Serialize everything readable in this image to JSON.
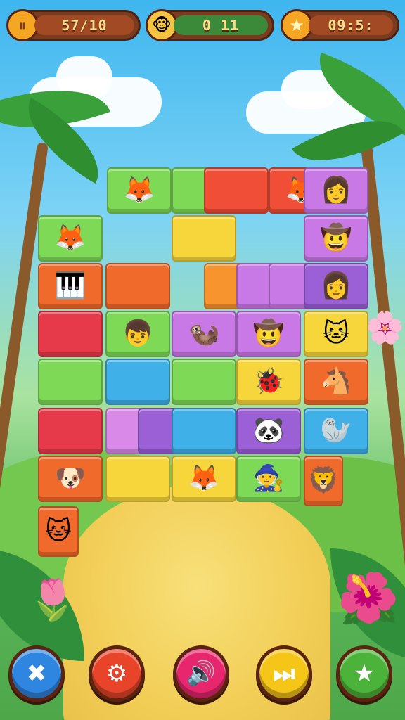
{
  "hud": {
    "left": {
      "icon": "pause-icon",
      "value": "57/10",
      "icon_color": "#f5a623"
    },
    "center": {
      "icon": "avatar-icon",
      "value": "0 11",
      "icon_color": "#f5c542"
    },
    "right": {
      "icon": "star-icon",
      "value": "09:5:",
      "icon_color": "#f5a623"
    }
  },
  "tiles": [
    {
      "color": "#7ed957",
      "icon": "fox-icon",
      "glyph": "🦊"
    },
    {
      "color": "#7ed957",
      "icon": "vine-icon",
      "glyph": ""
    },
    {
      "color": "#f04e37",
      "icon": "vine-icon",
      "glyph": ""
    },
    {
      "color": "#f04e37",
      "icon": "fox-icon",
      "glyph": "🦊"
    },
    {
      "color": "#c979e6",
      "icon": "girl-icon",
      "glyph": "👩"
    },
    {
      "color": "#7ed957",
      "icon": "fox-icon",
      "glyph": "🦊"
    },
    {
      "color": "#f7d63b",
      "icon": "vine-icon",
      "glyph": ""
    },
    {
      "color": "#c979e6",
      "icon": "explorer-icon",
      "glyph": "🤠"
    },
    {
      "color": "#f06a2b",
      "icon": "piano-icon",
      "glyph": "🎹"
    },
    {
      "color": "#f06a2b",
      "icon": "vine-icon",
      "glyph": ""
    },
    {
      "color": "#f7942e",
      "icon": "vine-icon",
      "glyph": ""
    },
    {
      "color": "#c979e6",
      "icon": "vine-icon",
      "glyph": ""
    },
    {
      "color": "#c979e6",
      "icon": "blank",
      "glyph": ""
    },
    {
      "color": "#9b5fd6",
      "icon": "girl-icon",
      "glyph": "👩"
    },
    {
      "color": "#e63a4a",
      "icon": "blank",
      "glyph": ""
    },
    {
      "color": "#7ed957",
      "icon": "boy-icon",
      "glyph": "👦"
    },
    {
      "color": "#c979e6",
      "icon": "meerkat-icon",
      "glyph": "🦦"
    },
    {
      "color": "#c979e6",
      "icon": "explorer-icon",
      "glyph": "🤠"
    },
    {
      "color": "#f7d63b",
      "icon": "cat-icon",
      "glyph": "🐱"
    },
    {
      "color": "#7ed957",
      "icon": "vine-icon",
      "glyph": ""
    },
    {
      "color": "#3fb0e8",
      "icon": "vine-icon",
      "glyph": ""
    },
    {
      "color": "#7ed957",
      "icon": "blank",
      "glyph": ""
    },
    {
      "color": "#f7d63b",
      "icon": "ladybug-icon",
      "glyph": "🐞"
    },
    {
      "color": "#f06a2b",
      "icon": "horse-icon",
      "glyph": "🐴"
    },
    {
      "color": "#e63a4a",
      "icon": "blank",
      "glyph": ""
    },
    {
      "color": "#d98ae8",
      "icon": "vine-icon",
      "glyph": ""
    },
    {
      "color": "#9b5fd6",
      "icon": "vine-icon",
      "glyph": ""
    },
    {
      "color": "#3fb0e8",
      "icon": "vine-icon",
      "glyph": ""
    },
    {
      "color": "#9b5fd6",
      "icon": "panda-icon",
      "glyph": "🐼"
    },
    {
      "color": "#3fb0e8",
      "icon": "seal-icon",
      "glyph": "🦭"
    },
    {
      "color": "#f06a2b",
      "icon": "dog-icon",
      "glyph": "🐶"
    },
    {
      "color": "#f7d63b",
      "icon": "vine-icon",
      "glyph": ""
    },
    {
      "color": "#f7d63b",
      "icon": "fox-icon",
      "glyph": "🦊"
    },
    {
      "color": "#7ed957",
      "icon": "wizard-icon",
      "glyph": "🧙"
    },
    {
      "color": "#f06a2b",
      "icon": "lion-icon",
      "glyph": "🦁"
    },
    {
      "color": "#f06a2b",
      "icon": "cat-icon",
      "glyph": "🐱"
    }
  ],
  "buttons": [
    {
      "name": "tools-button",
      "icon": "crossed-tools-icon",
      "glyph": "✖",
      "color": "#2f86e0"
    },
    {
      "name": "settings-button",
      "icon": "gear-icon",
      "glyph": "⚙",
      "color": "#e8442a"
    },
    {
      "name": "sound-button",
      "icon": "sound-icon",
      "glyph": "🔊",
      "color": "#e8266e"
    },
    {
      "name": "skip-button",
      "icon": "skip-icon",
      "glyph": "⏭",
      "color": "#f5c518"
    },
    {
      "name": "hint-button",
      "icon": "star-badge-icon",
      "glyph": "★",
      "color": "#4cb33a"
    }
  ]
}
